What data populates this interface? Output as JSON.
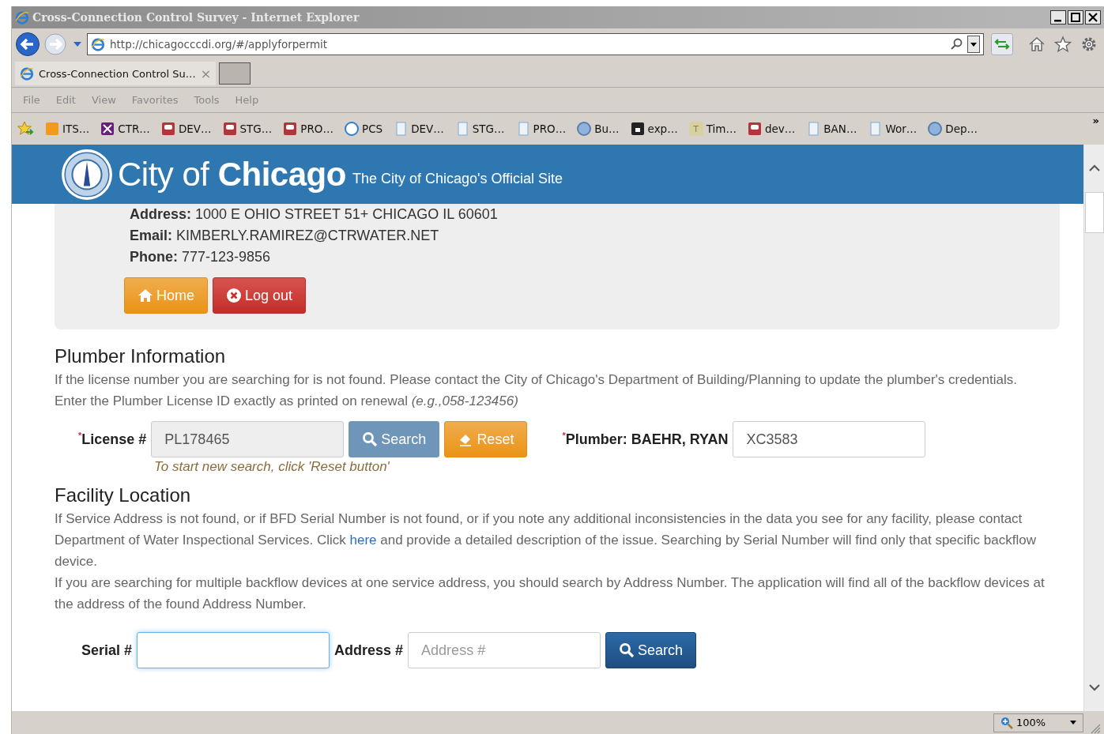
{
  "window": {
    "title": "Cross-Connection Control Survey - Internet Explorer"
  },
  "address_bar": {
    "url": "http://chicagocccdi.org/#/applyforpermit"
  },
  "tab": {
    "title": "Cross-Connection Control Su…",
    "close": "×"
  },
  "menu": [
    "File",
    "Edit",
    "View",
    "Favorites",
    "Tools",
    "Help"
  ],
  "favorites": [
    {
      "kind": "tiles",
      "label": "ITS…"
    },
    {
      "kind": "vs",
      "label": "CTR…"
    },
    {
      "kind": "db",
      "label": "DEV…"
    },
    {
      "kind": "db",
      "label": "STG…"
    },
    {
      "kind": "db",
      "label": "PRO…"
    },
    {
      "kind": "ie",
      "label": "PCS"
    },
    {
      "kind": "doc",
      "label": "DEV…"
    },
    {
      "kind": "doc",
      "label": "STG…"
    },
    {
      "kind": "doc",
      "label": "PRO…"
    },
    {
      "kind": "seal",
      "label": "Bu…"
    },
    {
      "kind": "lock",
      "label": "exp…"
    },
    {
      "kind": "letter",
      "glyph": "T",
      "label": "Tim…"
    },
    {
      "kind": "db",
      "label": "dev…"
    },
    {
      "kind": "doc",
      "label": "BAN…"
    },
    {
      "kind": "doc",
      "label": "Wor…"
    },
    {
      "kind": "seal",
      "label": "Dep…"
    }
  ],
  "favorites_more": "»",
  "site_header": {
    "city": "City",
    "of": "of",
    "name": "Chicago",
    "tagline": "The City of Chicago's Official Site"
  },
  "account": {
    "fields": [
      {
        "label": "Address:",
        "value": "1000 E OHIO STREET 51+ CHICAGO IL 60601"
      },
      {
        "label": "Email:",
        "value": "KIMBERLY.RAMIREZ@CTRWATER.NET"
      },
      {
        "label": "Phone:",
        "value": "777-123-9856"
      }
    ],
    "buttons": [
      {
        "kind": "home",
        "label": "Home"
      },
      {
        "kind": "logout",
        "label": "Log out"
      }
    ]
  },
  "plumber": {
    "title": "Plumber Information",
    "text": "If the license number you are searching for is not found. Please contact the City of Chicago's Department of Building/Planning to update the plumber's credentials.",
    "instruction": "Enter the Plumber License ID exactly as printed on renewal *(e.g.,058-123456)*",
    "license_label": "$^{*}$License #",
    "license_value": "PL178465",
    "license_disabled": true,
    "search": "Search",
    "search_disabled": true,
    "reset": "Reset",
    "hint": "To start new search, click 'Reset button'",
    "plumber_label": "$^{*}$Plumber: BAEHR, RYAN",
    "plumber_value": "XC3583"
  },
  "facility": {
    "title": "Facility Location",
    "text_before": "If Service Address is not found, or if BFD Serial Number is not found, or if you note any additional inconsistencies in the data you see for any facility, please contact Department of Water Inspectional Services. Click",
    "link": "here",
    "text_after": "and provide a detailed description of the issue. Searching by Serial Number will find only that specific backflow device.",
    "text2": "If you are searching for multiple backflow devices at one service address, you should search by Address Number. The application will find all of the backflow devices at the address of the found Address Number.",
    "serial_label": "Serial #",
    "serial_focused": true,
    "address_label": "Address #",
    "address_placeholder": "Address #",
    "search": "Search"
  },
  "status_bar": {
    "zoom": "100%"
  }
}
